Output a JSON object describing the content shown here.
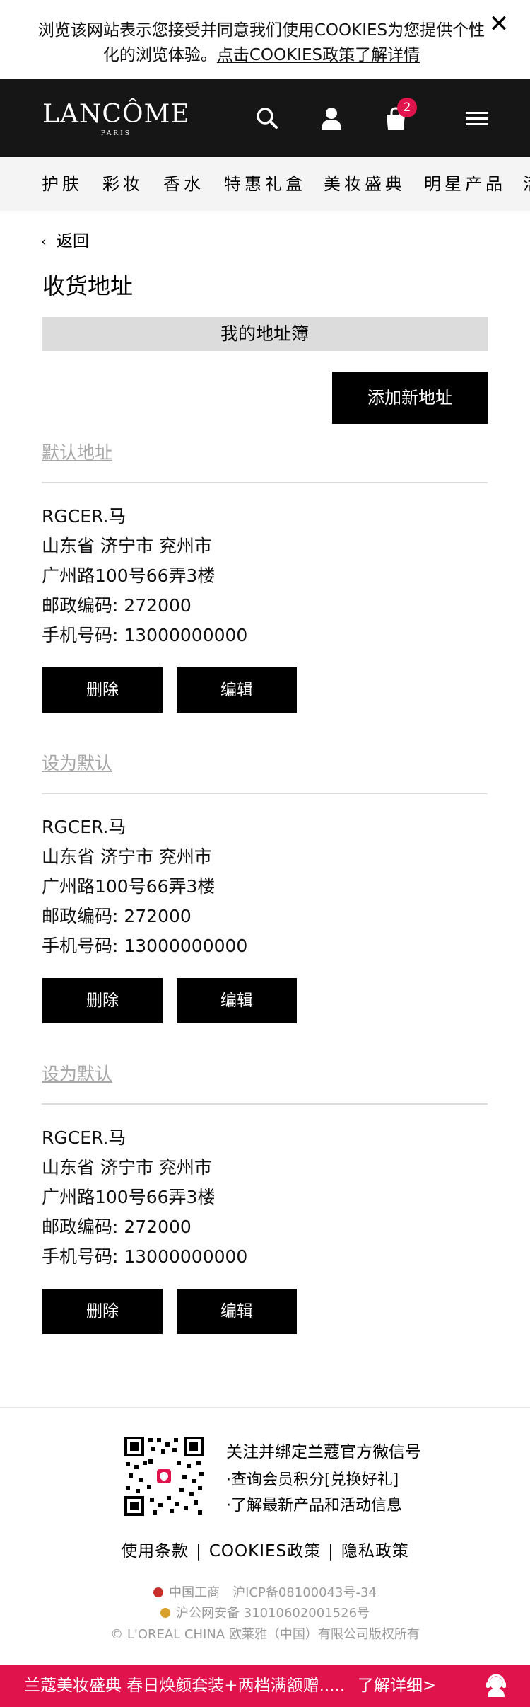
{
  "cookie_banner": {
    "text": "浏览该网站表示您接受并同意我们使用COOKIES为您提供个性化的浏览体验。",
    "link": "点击COOKIES政策了解详情"
  },
  "header": {
    "logo": "LANCÔME",
    "logo_sub": "PARIS",
    "cart_count": "2",
    "icons": [
      "search-icon",
      "account-icon",
      "cart-icon",
      "menu-icon"
    ]
  },
  "nav": {
    "items": [
      "护肤",
      "彩妆",
      "香水",
      "特惠礼盒",
      "美妆盛典",
      "明星产品",
      "活"
    ]
  },
  "page": {
    "back_label": "返回",
    "title": "收货地址",
    "book_label": "我的地址簿",
    "add_button": "添加新地址"
  },
  "addresses": [
    {
      "heading": "默认地址",
      "name": "RGCER.马",
      "region": "山东省 济宁市 兖州市",
      "street": "广州路100号66弄3楼",
      "postcode": "邮政编码: 272000",
      "phone": "手机号码: 13000000000",
      "delete_label": "删除",
      "edit_label": "编辑"
    },
    {
      "heading": "设为默认",
      "name": "RGCER.马",
      "region": "山东省 济宁市 兖州市",
      "street": "广州路100号66弄3楼",
      "postcode": "邮政编码: 272000",
      "phone": "手机号码: 13000000000",
      "delete_label": "删除",
      "edit_label": "编辑"
    },
    {
      "heading": "设为默认",
      "name": "RGCER.马",
      "region": "山东省 济宁市 兖州市",
      "street": "广州路100号66弄3楼",
      "postcode": "邮政编码: 272000",
      "phone": "手机号码: 13000000000",
      "delete_label": "删除",
      "edit_label": "编辑"
    }
  ],
  "footer": {
    "wechat_title": "关注并绑定兰蔻官方微信号",
    "wechat_line1": "·查询会员积分[兑换好礼]",
    "wechat_line2": "·了解最新产品和活动信息",
    "link_terms": "使用条款",
    "link_cookies": "COOKIES政策",
    "link_privacy": "隐私政策",
    "separator": "|",
    "icp": "中国工商　沪ICP备08100043号-34",
    "police": "沪公网安备 31010602001526号",
    "copyright": "© L'OREAL CHINA 欧莱雅（中国）有限公司版权所有"
  },
  "promo": {
    "text": "兰蔻美妆盛典 春日焕颜套装+两档满额赠.....",
    "more": "了解详细>"
  },
  "colors": {
    "header_bg": "#161616",
    "accent": "#e0134d",
    "nav_bg": "#f4f4f4",
    "muted": "#a7a7a7"
  }
}
